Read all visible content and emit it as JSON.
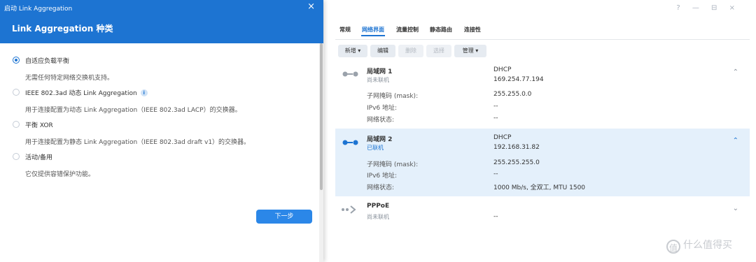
{
  "dialog": {
    "titlebar": "启动 Link Aggregation",
    "close": "×",
    "header": "Link Aggregation 种类",
    "options": [
      {
        "label": "自适应负载平衡",
        "desc": "无需任何特定网络交换机支持。",
        "selected": true
      },
      {
        "label": "IEEE 802.3ad 动态 Link Aggregation",
        "desc": "用于连接配置为动态 Link Aggregation（IEEE 802.3ad LACP）的交换器。",
        "info": "i"
      },
      {
        "label": "平衡 XOR",
        "desc": "用于连接配置为静态 Link Aggregation（IEEE 802.3ad draft v1）的交换器。"
      },
      {
        "label": "活动/备用",
        "desc": "它仅提供容错保护功能。"
      }
    ],
    "next_button": "下一步"
  },
  "window": {
    "controls": [
      "?",
      "—",
      "⊟",
      "×"
    ]
  },
  "tabs": [
    "常规",
    "网络界面",
    "流量控制",
    "静态路由",
    "连接性"
  ],
  "toolbar": {
    "add": "新增 ▾",
    "edit": "编辑",
    "delete": "删除",
    "select": "选择",
    "manage": "管理 ▾"
  },
  "interfaces": [
    {
      "name": "局域网 1",
      "status": "尚未联机",
      "mode": "DHCP",
      "ip": "169.254.77.194",
      "subnet_label": "子网掩码 (mask):",
      "subnet": "255.255.0.0",
      "ipv6_label": "IPv6 地址:",
      "ipv6": "--",
      "net_label": "网络状态:",
      "net": "--",
      "chevron": "⌃"
    },
    {
      "name": "局域网 2",
      "status": "已联机",
      "mode": "DHCP",
      "ip": "192.168.31.82",
      "subnet_label": "子网掩码 (mask):",
      "subnet": "255.255.255.0",
      "ipv6_label": "IPv6 地址:",
      "ipv6": "--",
      "net_label": "网络状态:",
      "net": "1000 Mb/s, 全双工, MTU 1500",
      "chevron": "⌃"
    },
    {
      "name": "PPPoE",
      "status": "尚未联机",
      "value": "--",
      "chevron": "⌄"
    }
  ],
  "colors": {
    "accent": "#1d74d2",
    "selected_row": "#e4f0fb"
  },
  "watermark": {
    "icon": "值",
    "text": "什么值得买"
  }
}
